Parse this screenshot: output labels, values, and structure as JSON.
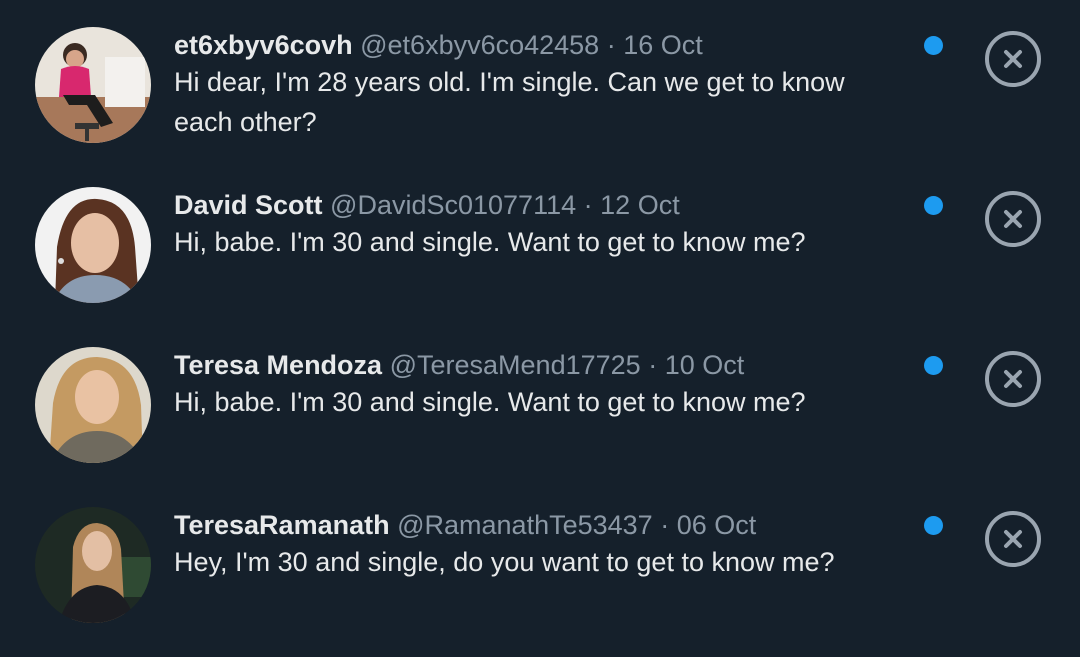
{
  "messages": [
    {
      "name": "et6xbyv6covh",
      "handle": "@et6xbyv6co42458",
      "separator": "·",
      "date": "16 Oct",
      "text": "Hi dear, I'm 28 years old. I'm single. Can we get to know each other?"
    },
    {
      "name": "David Scott",
      "handle": "@DavidSc01077114",
      "separator": "·",
      "date": "12 Oct",
      "text": "Hi, babe. I'm 30 and single. Want to get to know me?"
    },
    {
      "name": "Teresa Mendoza",
      "handle": "@TeresaMend17725",
      "separator": "·",
      "date": "10 Oct",
      "text": "Hi, babe. I'm 30 and single. Want to get to know me?"
    },
    {
      "name": "TeresaRamanath",
      "handle": "@RamanathTe53437",
      "separator": "·",
      "date": "06 Oct",
      "text": "Hey, I'm 30 and single, do you want to get to know me?"
    }
  ],
  "colors": {
    "background": "#15202b",
    "primary_text": "#e7e9ea",
    "secondary_text": "#8b98a5",
    "unread_dot": "#1d9bf0",
    "dismiss_icon": "#9aa5b0"
  },
  "icons": {
    "unread": "unread-dot-icon",
    "dismiss": "close-circle-icon"
  }
}
